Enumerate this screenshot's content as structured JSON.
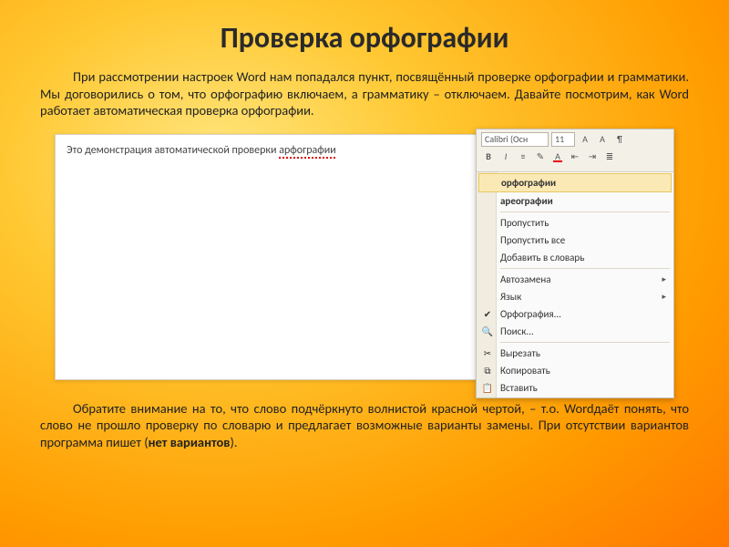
{
  "title": "Проверка орфографии",
  "paragraph1": "При рассмотрении настроек Word нам попадался пункт, посвящённый проверке орфографии и грамматики.  Мы договорились о том, что орфографию включаем, а грамматику – отключаем. Давайте посмотрим, как Word работает автоматическая проверка орфографии.",
  "doc": {
    "prefix": "Это демонстрация автоматической проверки ",
    "misspelled": "арфографии"
  },
  "ribbon": {
    "font_name": "Calibri (Осн",
    "font_size": "11"
  },
  "context_menu": {
    "suggestion1": "орфографии",
    "suggestion2": "ареографии",
    "skip": "Пропустить",
    "skip_all": "Пропустить все",
    "add_dict": "Добавить в словарь",
    "autocorrect": "Автозамена",
    "language": "Язык",
    "spelling": "Орфография...",
    "find": "Поиск...",
    "cut": "Вырезать",
    "copy": "Копировать",
    "paste": "Вставить"
  },
  "paragraph2_a": "Обратите внимание на то, что слово подчёркнуто волнистой красной чертой, – т.о. Wordдаёт понять, что слово не прошло проверку по словарю и предлагает возможные варианты замены. При отсутствии вариантов программа пишет (",
  "paragraph2_bold": "нет вариантов",
  "paragraph2_b": ")."
}
